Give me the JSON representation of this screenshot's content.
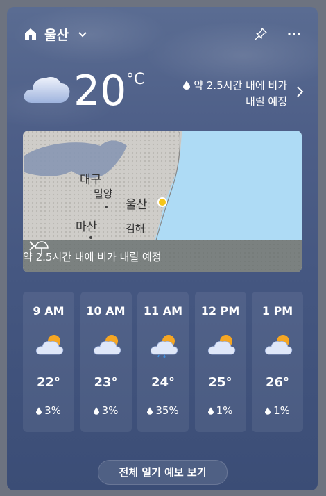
{
  "header": {
    "location": "울산"
  },
  "current": {
    "temperature": "20",
    "unit": "°C",
    "rain_note_line1": "약 2.5시간 내에 비가",
    "rain_note_line2": "내릴 예정"
  },
  "map": {
    "labels": [
      "대구",
      "밀양",
      "울산",
      "마산",
      "김해"
    ],
    "bar_text": "약 2.5시간 내에 비가 내릴 예정"
  },
  "hourly": [
    {
      "time": "9 AM",
      "temp": "22°",
      "precip": "3%",
      "icon": "partly-cloudy-icon"
    },
    {
      "time": "10 AM",
      "temp": "23°",
      "precip": "3%",
      "icon": "partly-cloudy-icon"
    },
    {
      "time": "11 AM",
      "temp": "24°",
      "precip": "35%",
      "icon": "rain-showers-icon"
    },
    {
      "time": "12 PM",
      "temp": "25°",
      "precip": "1%",
      "icon": "partly-cloudy-icon"
    },
    {
      "time": "1 PM",
      "temp": "26°",
      "precip": "1%",
      "icon": "partly-cloudy-icon"
    }
  ],
  "footer": {
    "button_label": "전체 일기 예보 보기"
  },
  "colors": {
    "sun": "#f5a623",
    "rain_drop": "#3d8fe0",
    "map_sea": "#aedbf5",
    "location_dot": "#f5c518"
  }
}
